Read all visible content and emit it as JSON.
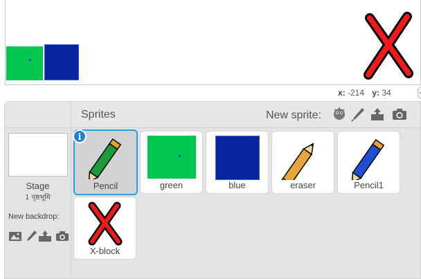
{
  "stage": {
    "coords": {
      "x_label": "x:",
      "x_value": "-214",
      "y_label": "y:",
      "y_value": "34"
    }
  },
  "sprites_pane": {
    "title": "Sprites",
    "new_sprite_label": "New sprite:",
    "new_sprite_tools": [
      "choose-from-library-icon",
      "paint-brush-icon",
      "upload-icon",
      "camera-icon"
    ],
    "sprites": [
      {
        "name": "Pencil",
        "selected": true,
        "icon": "green-pencil-icon"
      },
      {
        "name": "green",
        "selected": false,
        "icon": "green-square-icon"
      },
      {
        "name": "blue",
        "selected": false,
        "icon": "blue-square-icon"
      },
      {
        "name": "eraser",
        "selected": false,
        "icon": "eraser-pencil-icon"
      },
      {
        "name": "Pencil1",
        "selected": false,
        "icon": "blue-pencil-icon"
      },
      {
        "name": "X-block",
        "selected": false,
        "icon": "red-x-icon"
      }
    ],
    "info_badge": "i"
  },
  "stage_panel": {
    "label": "Stage",
    "sub_label": "1 पृष्ठभूमि",
    "new_backdrop_label": "New backdrop:",
    "backdrop_tools": [
      "backdrop-library-icon",
      "paint-brush-icon",
      "upload-icon",
      "camera-icon"
    ]
  },
  "colors": {
    "green": "#00c74f",
    "blue": "#0a24a0",
    "selected_border": "#27a0e0",
    "x_red": "#f01a1a"
  }
}
